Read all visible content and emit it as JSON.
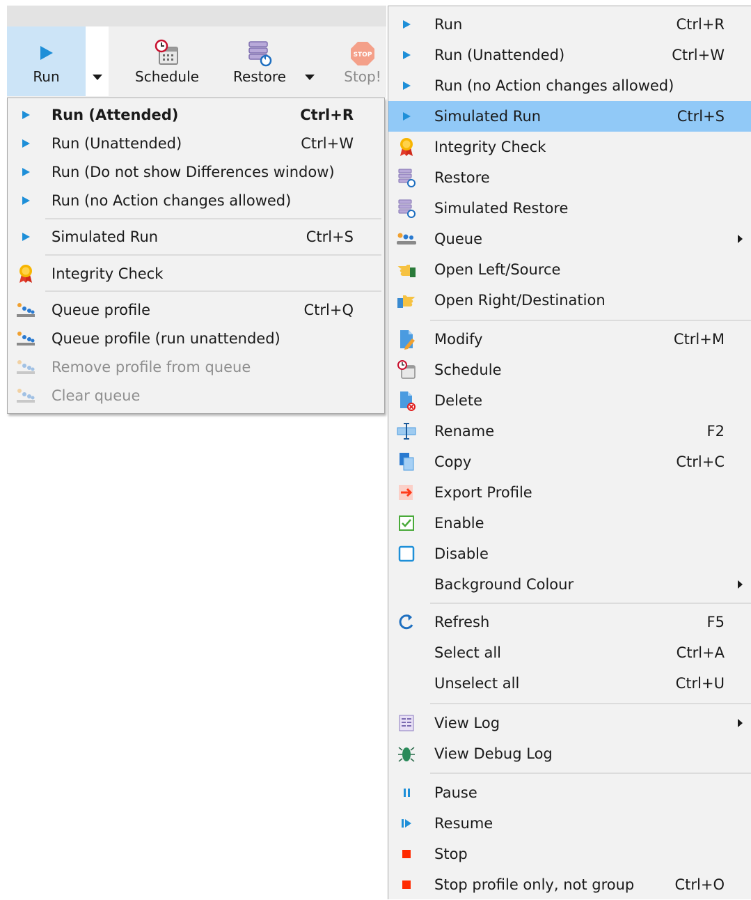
{
  "toolbar": {
    "run_label": "Run",
    "schedule_label": "Schedule",
    "restore_label": "Restore",
    "stop_label": "Stop!",
    "stop_icon_text": "STOP"
  },
  "run_menu": {
    "items": [
      {
        "label": "Run (Attended)",
        "shortcut": "Ctrl+R",
        "icon": "play-icon"
      },
      {
        "label": "Run (Unattended)",
        "shortcut": "Ctrl+W",
        "icon": "play-icon"
      },
      {
        "label": "Run (Do not show Differences window)",
        "shortcut": "",
        "icon": "play-icon"
      },
      {
        "label": "Run (no Action changes allowed)",
        "shortcut": "",
        "icon": "play-icon"
      },
      {
        "label": "Simulated Run",
        "shortcut": "Ctrl+S",
        "icon": "play-icon"
      },
      {
        "label": "Integrity Check",
        "shortcut": "",
        "icon": "medal-icon"
      },
      {
        "label": "Queue profile",
        "shortcut": "Ctrl+Q",
        "icon": "queue-icon"
      },
      {
        "label": "Queue profile (run unattended)",
        "shortcut": "",
        "icon": "queue-icon"
      },
      {
        "label": "Remove profile from queue",
        "shortcut": "",
        "icon": "queue-icon"
      },
      {
        "label": "Clear queue",
        "shortcut": "",
        "icon": "queue-icon"
      }
    ]
  },
  "context_menu": {
    "items": [
      {
        "label": "Run",
        "shortcut": "Ctrl+R",
        "icon": "play-icon"
      },
      {
        "label": "Run (Unattended)",
        "shortcut": "Ctrl+W",
        "icon": "play-icon"
      },
      {
        "label": "Run (no Action changes allowed)",
        "shortcut": "",
        "icon": "play-icon"
      },
      {
        "label": "Simulated Run",
        "shortcut": "Ctrl+S",
        "icon": "play-icon"
      },
      {
        "label": "Integrity Check",
        "shortcut": "",
        "icon": "medal-icon"
      },
      {
        "label": "Restore",
        "shortcut": "",
        "icon": "restore-icon"
      },
      {
        "label": "Simulated Restore",
        "shortcut": "",
        "icon": "restore-icon"
      },
      {
        "label": "Queue",
        "shortcut": "",
        "icon": "queue-icon"
      },
      {
        "label": "Open Left/Source",
        "shortcut": "",
        "icon": "hand-left-icon"
      },
      {
        "label": "Open Right/Destination",
        "shortcut": "",
        "icon": "hand-right-icon"
      },
      {
        "label": "Modify",
        "shortcut": "Ctrl+M",
        "icon": "edit-icon"
      },
      {
        "label": "Schedule",
        "shortcut": "",
        "icon": "schedule-icon"
      },
      {
        "label": "Delete",
        "shortcut": "",
        "icon": "delete-icon"
      },
      {
        "label": "Rename",
        "shortcut": "F2",
        "icon": "rename-icon"
      },
      {
        "label": "Copy",
        "shortcut": "Ctrl+C",
        "icon": "copy-icon"
      },
      {
        "label": "Export Profile",
        "shortcut": "",
        "icon": "export-icon"
      },
      {
        "label": "Enable",
        "shortcut": "",
        "icon": "checkbox-checked-icon"
      },
      {
        "label": "Disable",
        "shortcut": "",
        "icon": "checkbox-empty-icon"
      },
      {
        "label": "Background Colour",
        "shortcut": "",
        "icon": ""
      },
      {
        "label": "Refresh",
        "shortcut": "F5",
        "icon": "refresh-icon"
      },
      {
        "label": "Select all",
        "shortcut": "Ctrl+A",
        "icon": ""
      },
      {
        "label": "Unselect all",
        "shortcut": "Ctrl+U",
        "icon": ""
      },
      {
        "label": "View Log",
        "shortcut": "",
        "icon": "log-icon"
      },
      {
        "label": "View Debug Log",
        "shortcut": "",
        "icon": "bug-icon"
      },
      {
        "label": "Pause",
        "shortcut": "",
        "icon": "pause-icon"
      },
      {
        "label": "Resume",
        "shortcut": "",
        "icon": "resume-icon"
      },
      {
        "label": "Stop",
        "shortcut": "",
        "icon": "stop-icon"
      },
      {
        "label": "Stop profile only, not group",
        "shortcut": "Ctrl+O",
        "icon": "stop-icon"
      }
    ]
  },
  "colors": {
    "highlight": "#91c9f7",
    "run_button_bg": "#cce4f7",
    "accent_blue": "#1e8fd8",
    "stop_red": "#ff2a00"
  }
}
